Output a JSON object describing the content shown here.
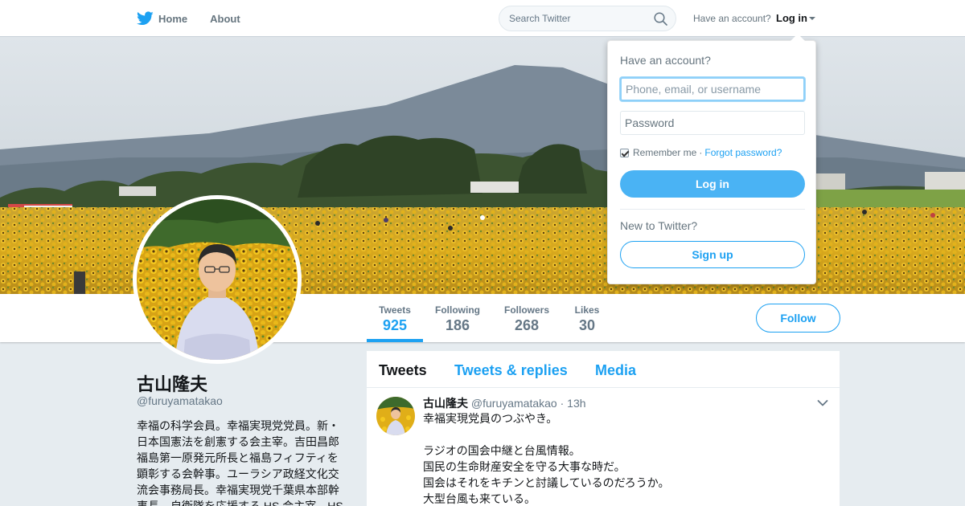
{
  "nav": {
    "home_label": "Home",
    "about_label": "About",
    "search_placeholder": "Search Twitter",
    "have_account": "Have an account?",
    "login_label": "Log in"
  },
  "profile": {
    "name": "古山隆夫",
    "handle": "@furuyamatakao",
    "bio_lines": [
      "幸福の科学会員。幸福実現党党員。新・",
      "日本国憲法を創憲する会主宰。吉田昌郎",
      "福島第一原発元所長と福島フィフティを",
      "顕彰する会幹事。ユーラシア政経文化交",
      "流会事務局長。幸福実現党千葉県本部幹",
      "事長。自衛隊を応援する HS 会主宰。HS"
    ],
    "follow_label": "Follow"
  },
  "stats": [
    {
      "label": "Tweets",
      "value": "925"
    },
    {
      "label": "Following",
      "value": "186"
    },
    {
      "label": "Followers",
      "value": "268"
    },
    {
      "label": "Likes",
      "value": "30"
    }
  ],
  "timeline": {
    "tabs": [
      "Tweets",
      "Tweets & replies",
      "Media"
    ],
    "tweet": {
      "name": "古山隆夫",
      "handle": "@furuyamatakao",
      "dot": "·",
      "time": "13h",
      "lines": [
        "幸福実現党員のつぶやき。",
        "",
        "ラジオの国会中継と台風情報。",
        "国民の生命財産安全を守る大事な時だ。",
        "国会はそれをキチンと討議しているのだろうか。",
        "大型台風も来ている。"
      ]
    }
  },
  "login_dropdown": {
    "title": "Have an account?",
    "username_placeholder": "Phone, email, or username",
    "password_placeholder": "Password",
    "remember_label": "Remember me",
    "separator": "·",
    "forgot_label": "Forgot password?",
    "login_button": "Log in",
    "new_label": "New to Twitter?",
    "signup_button": "Sign up"
  },
  "colors": {
    "accent": "#1da1f2",
    "login_button_bg": "#4ab3f4",
    "page_bg": "#e6ecf0"
  },
  "icons": {
    "logo": "twitter-bird-icon",
    "search": "search-icon",
    "caret": "caret-down-icon",
    "tweet_menu": "chevron-down-icon"
  }
}
